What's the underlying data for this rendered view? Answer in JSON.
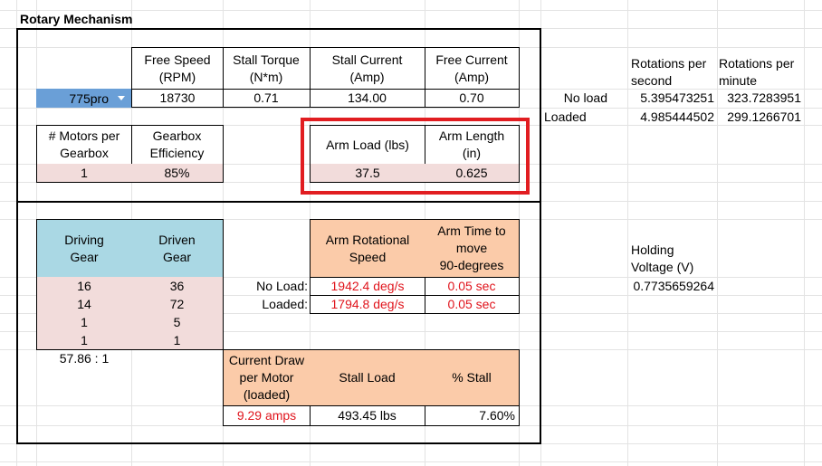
{
  "sheet": {
    "title": "Rotary Mechanism"
  },
  "motor": {
    "selected": "775pro",
    "headers": {
      "free_speed": [
        "Free Speed",
        "(RPM)"
      ],
      "stall_torque": [
        "Stall Torque",
        "(N*m)"
      ],
      "stall_current": [
        "Stall Current",
        "(Amp)"
      ],
      "free_current": [
        "Free Current",
        "(Amp)"
      ]
    },
    "values": {
      "free_speed": "18730",
      "stall_torque": "0.71",
      "stall_current": "134.00",
      "free_current": "0.70"
    }
  },
  "gearbox": {
    "headers": {
      "motors": [
        "# Motors per",
        "Gearbox"
      ],
      "efficiency": [
        "Gearbox",
        "Efficiency"
      ]
    },
    "values": {
      "motors": "1",
      "efficiency": "85%"
    }
  },
  "arm": {
    "headers": {
      "load": "Arm Load (lbs)",
      "length": [
        "Arm Length",
        "(in)"
      ]
    },
    "values": {
      "load": "37.5",
      "length": "0.625"
    }
  },
  "gears": {
    "headers": {
      "driving": [
        "Driving",
        "Gear"
      ],
      "driven": [
        "Driven",
        "Gear"
      ]
    },
    "rows": [
      {
        "driving": "16",
        "driven": "36"
      },
      {
        "driving": "14",
        "driven": "72"
      },
      {
        "driving": "1",
        "driven": "5"
      },
      {
        "driving": "1",
        "driven": "1"
      }
    ],
    "ratio": "57.86 : 1"
  },
  "speed": {
    "headers": {
      "rot_speed": [
        "Arm Rotational",
        "Speed"
      ],
      "time90": [
        "Arm Time to",
        "move",
        "90-degrees"
      ]
    },
    "labels": {
      "noload": "No Load:",
      "loaded": "Loaded:"
    },
    "noload": {
      "speed": "1942.4 deg/s",
      "time": "0.05 sec"
    },
    "loaded": {
      "speed": "1794.8 deg/s",
      "time": "0.05 sec"
    }
  },
  "current": {
    "headers": {
      "draw": [
        "Current Draw",
        "per Motor",
        "(loaded)"
      ],
      "stall_load": "Stall Load",
      "pct_stall": "% Stall"
    },
    "values": {
      "draw": "9.29 amps",
      "stall_load": "493.45 lbs",
      "pct_stall": "7.60%"
    }
  },
  "side": {
    "headers": {
      "rps": [
        "Rotations per",
        "second"
      ],
      "rpm": [
        "Rotations per",
        "minute"
      ]
    },
    "rows": [
      {
        "label": "No load",
        "rps": "5.395473251",
        "rpm": "323.7283951"
      },
      {
        "label": "Loaded",
        "rps": "4.985444502",
        "rpm": "299.1266701"
      }
    ],
    "holding_label": [
      "Holding",
      "Voltage (V)"
    ],
    "holding_value": "0.7735659264"
  },
  "colors": {
    "highlight": "#e11d21",
    "pink": "#f2dcdb",
    "blue": "#aad8e4",
    "peach": "#fbcba9",
    "red_text": "#e0141c",
    "dropdown": "#6a9fd7"
  }
}
